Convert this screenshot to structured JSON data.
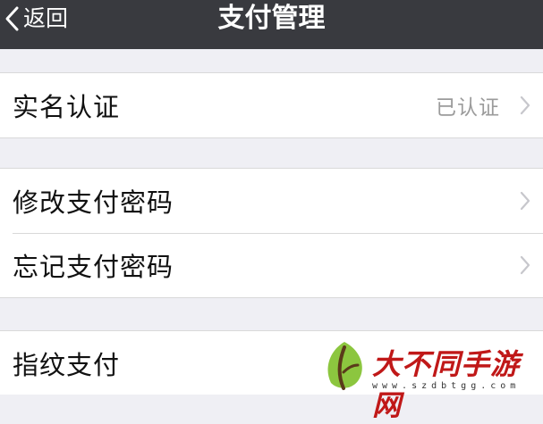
{
  "nav": {
    "back_label": "返回",
    "title": "支付管理"
  },
  "sections": [
    {
      "items": [
        {
          "label": "实名认证",
          "value": "已认证",
          "icon": "chevron-right-icon"
        }
      ]
    },
    {
      "items": [
        {
          "label": "修改支付密码",
          "icon": "chevron-right-icon"
        },
        {
          "label": "忘记支付密码",
          "icon": "chevron-right-icon"
        }
      ]
    },
    {
      "items": [
        {
          "label": "指纹支付"
        }
      ]
    }
  ],
  "watermark": {
    "title": "大不同手游网",
    "url": "www.szdbtgg.com"
  },
  "colors": {
    "navbar": "#393a3f",
    "background": "#efeff4",
    "cell": "#ffffff",
    "value_text": "#9b9b9b",
    "watermark_red": "#c01818"
  }
}
